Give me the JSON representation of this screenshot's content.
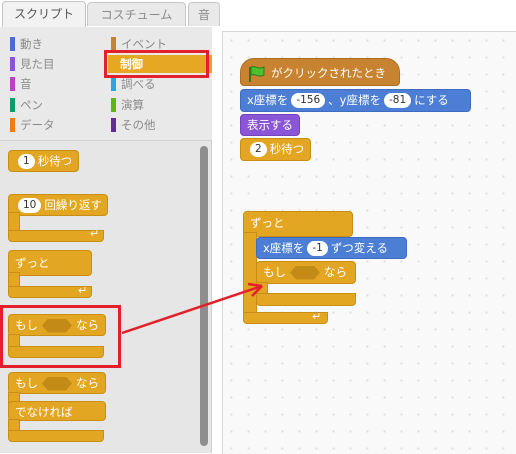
{
  "tabs": [
    "スクリプト",
    "コスチューム",
    "音"
  ],
  "categories": {
    "left": [
      {
        "label": "動き",
        "color": "#4a6cd4"
      },
      {
        "label": "見た目",
        "color": "#8a55d7"
      },
      {
        "label": "音",
        "color": "#bb42c3"
      },
      {
        "label": "ペン",
        "color": "#0e9a6c"
      },
      {
        "label": "データ",
        "color": "#ee7d16"
      }
    ],
    "right": [
      {
        "label": "イベント",
        "color": "#c88330"
      },
      {
        "label": "制御",
        "color": "#e6a822"
      },
      {
        "label": "調べる",
        "color": "#2ca5e2"
      },
      {
        "label": "演算",
        "color": "#5cb712"
      },
      {
        "label": "その他",
        "color": "#632d99"
      }
    ]
  },
  "palette_blocks": {
    "wait_num": "1",
    "wait_label": "秒待つ",
    "repeat_num": "10",
    "repeat_label": "回繰り返す",
    "forever_label": "ずっと",
    "if_label": "もし",
    "then_label": "なら",
    "ifelse_if": "もし",
    "ifelse_then": "なら",
    "else_label": "でなければ"
  },
  "script": {
    "hat_label": "がクリックされたとき",
    "goto_x_label": "x座標を",
    "goto_x_val": "-156",
    "goto_y_label": "、y座標を",
    "goto_y_val": "-81",
    "goto_end": "にする",
    "show_label": "表示する",
    "wait_num": "2",
    "wait_label": "秒待つ",
    "forever_label": "ずっと",
    "changex_label": "x座標を",
    "changex_val": "-1",
    "changex_end": "ずつ変える",
    "if_label": "もし",
    "then_label": "なら"
  },
  "annotation_color": "#e3202a"
}
